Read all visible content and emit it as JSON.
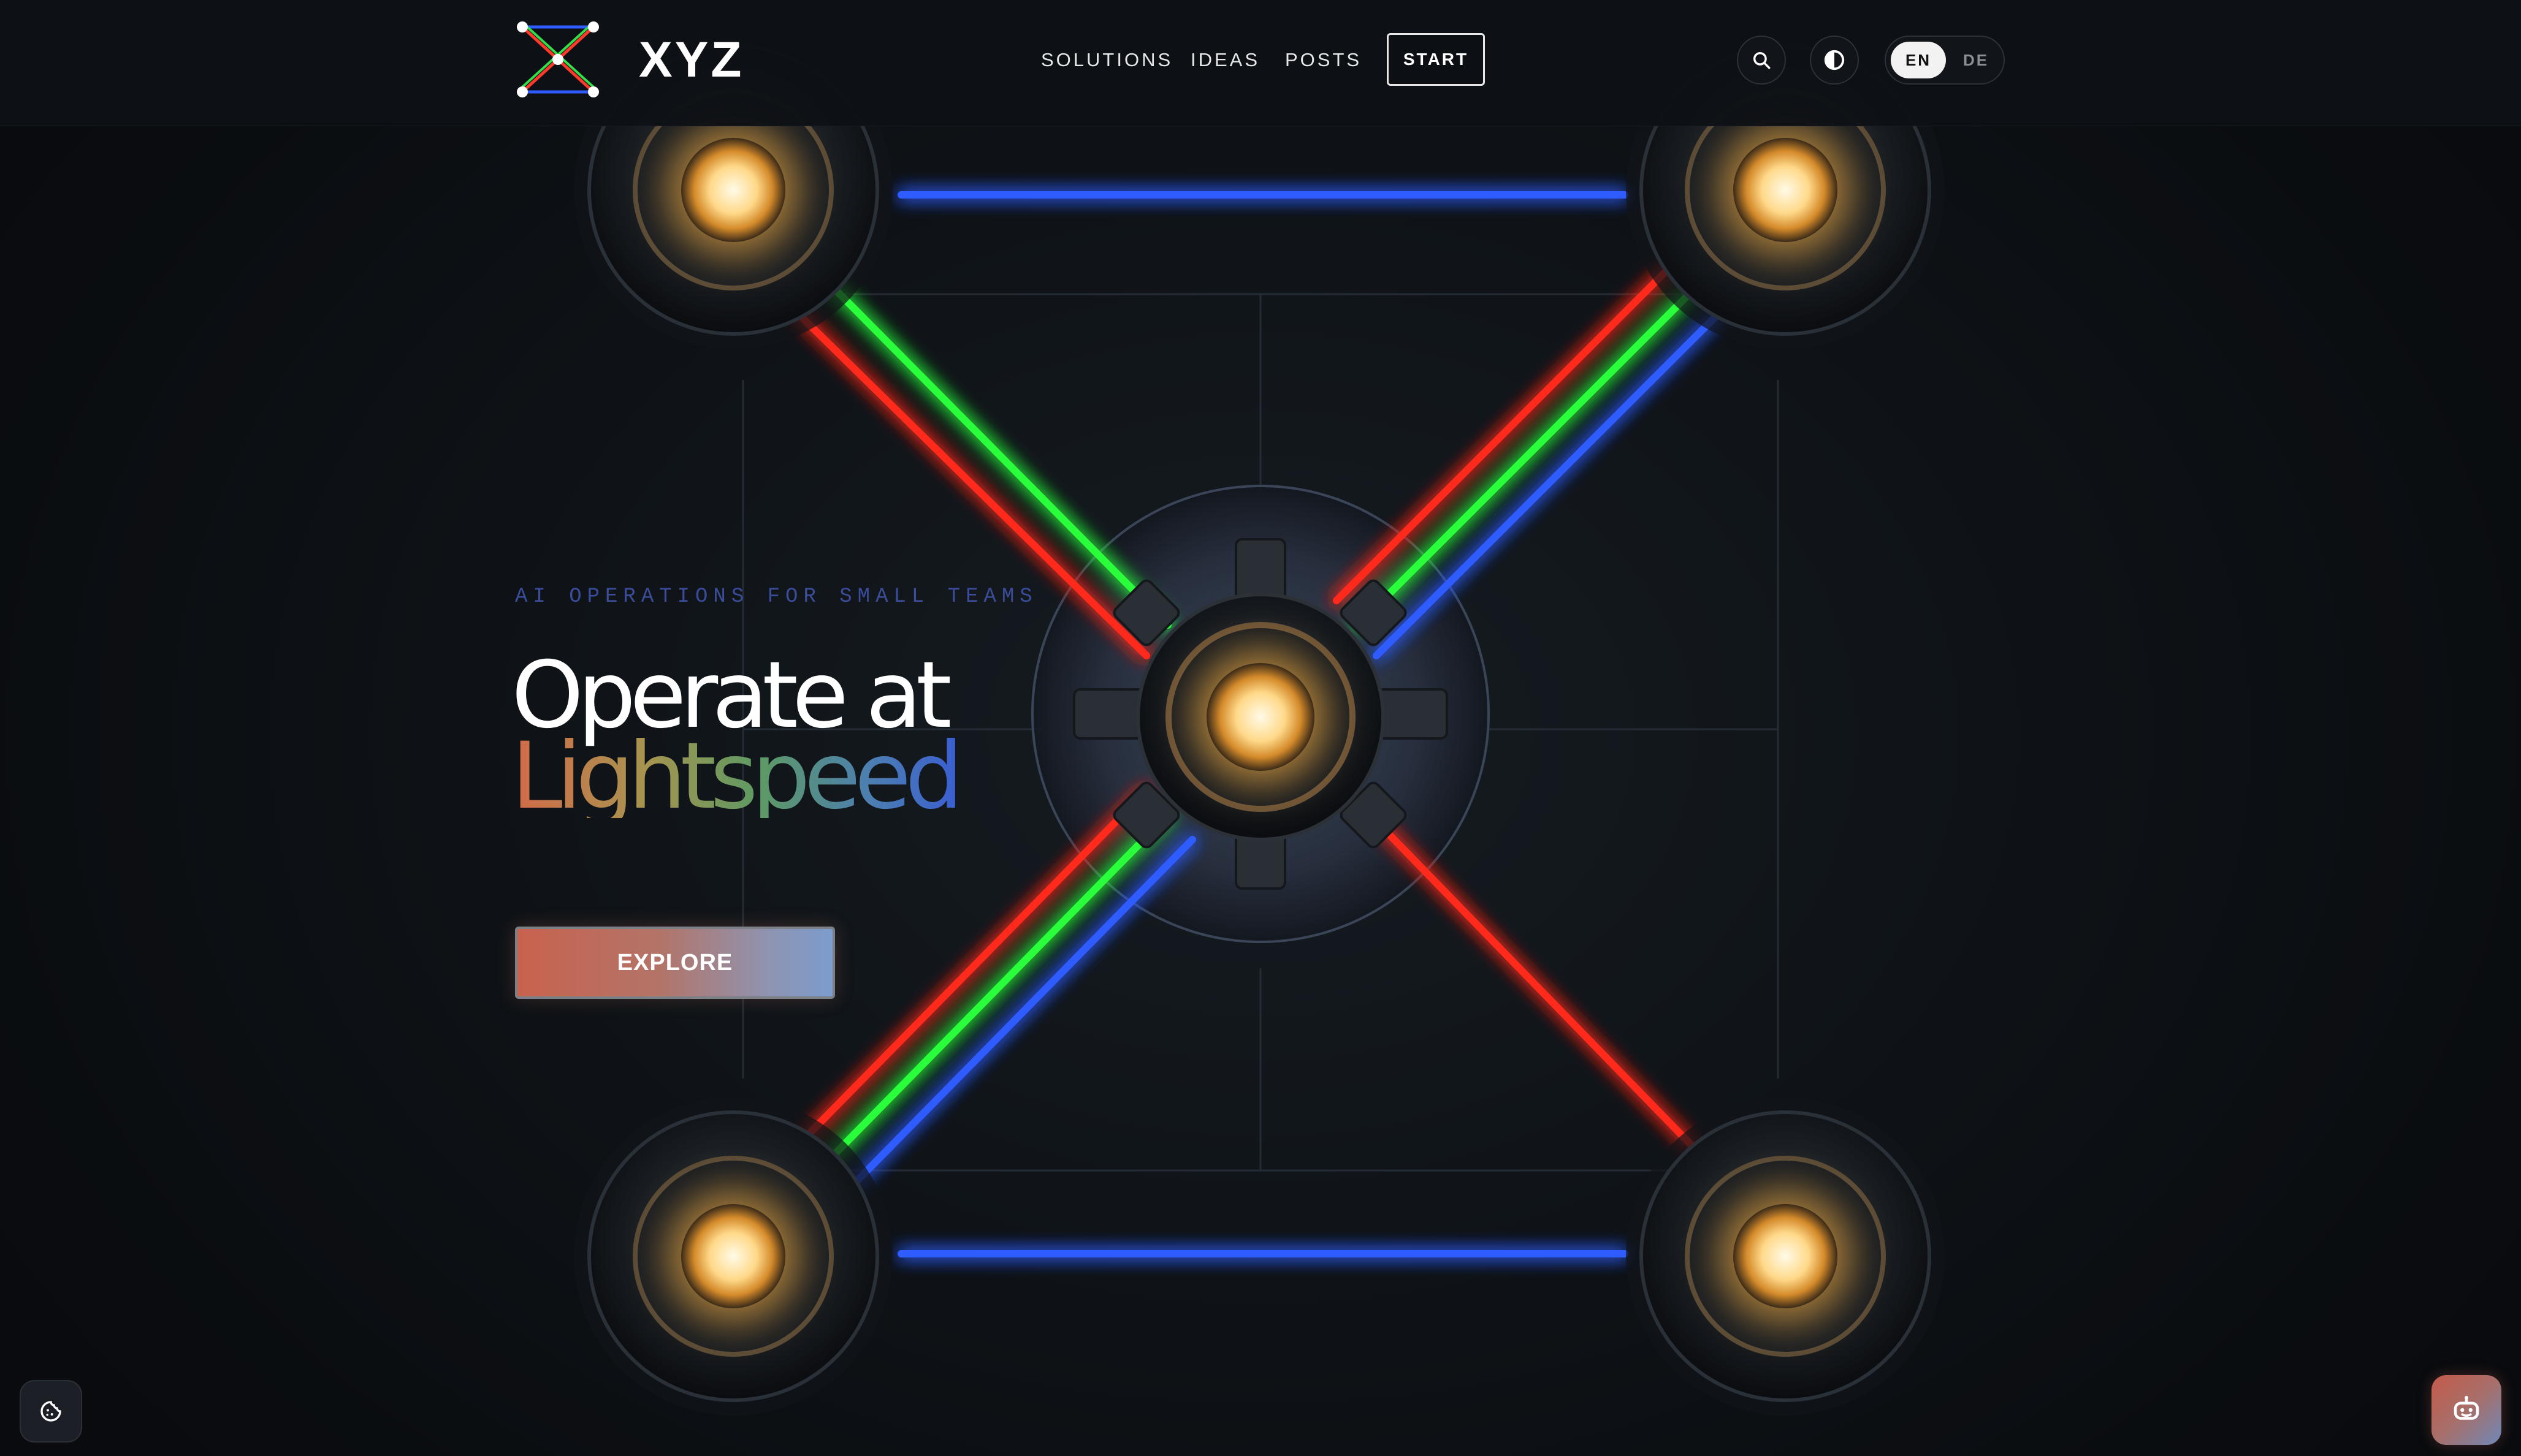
{
  "header": {
    "brand": "XYZ",
    "nav": [
      "SOLUTIONS",
      "IDEAS",
      "POSTS"
    ],
    "start_label": "START",
    "search_icon": "search-icon",
    "theme_icon": "contrast-icon",
    "language": {
      "options": [
        "EN",
        "DE"
      ],
      "selected": "EN"
    }
  },
  "hero": {
    "eyebrow": "AI OPERATIONS FOR SMALL TEAMS",
    "headline_line1": "Operate at",
    "headline_line2": "Lightspeed",
    "cta_label": "EXPLORE"
  },
  "floating": {
    "cookie_icon": "cookie-icon",
    "chat_icon": "chatbot-icon"
  },
  "colors": {
    "beam_red": "#ff2a1e",
    "beam_green": "#2aff3a",
    "beam_blue": "#1e4dff",
    "eyebrow": "#3b4c9a",
    "background": "#0c0f13"
  }
}
